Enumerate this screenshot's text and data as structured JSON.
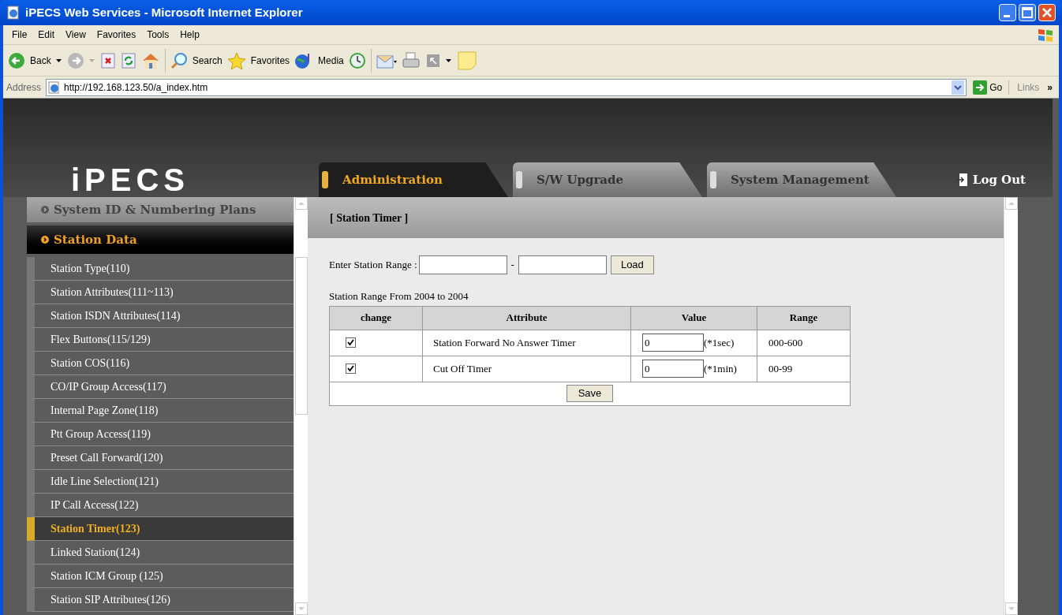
{
  "window": {
    "title": "iPECS Web Services - Microsoft Internet Explorer"
  },
  "menu": [
    "File",
    "Edit",
    "View",
    "Favorites",
    "Tools",
    "Help"
  ],
  "toolbar": {
    "back": "Back",
    "search": "Search",
    "favorites": "Favorites",
    "media": "Media"
  },
  "address_bar": {
    "label": "Address",
    "url": "http://192.168.123.50/a_index.htm",
    "go": "Go",
    "links": "Links",
    "more": "»"
  },
  "app": {
    "logo": "iPECS",
    "logout": "Log Out",
    "tabs": [
      {
        "label": "Administration",
        "selected": true
      },
      {
        "label": "S/W Upgrade",
        "selected": false
      },
      {
        "label": "System Management",
        "selected": false
      }
    ]
  },
  "sidebar": {
    "sections": [
      {
        "label": "System ID & Numbering Plans",
        "expanded": false
      },
      {
        "label": "Station Data",
        "expanded": true,
        "children": [
          {
            "label": "Station Type(110)",
            "selected": false
          },
          {
            "label": "Station Attributes(111~113)",
            "selected": false
          },
          {
            "label": "Station ISDN Attributes(114)",
            "selected": false
          },
          {
            "label": "Flex Buttons(115/129)",
            "selected": false
          },
          {
            "label": "Station COS(116)",
            "selected": false
          },
          {
            "label": "CO/IP Group Access(117)",
            "selected": false
          },
          {
            "label": "Internal Page Zone(118)",
            "selected": false
          },
          {
            "label": "Ptt Group Access(119)",
            "selected": false
          },
          {
            "label": "Preset Call Forward(120)",
            "selected": false
          },
          {
            "label": "Idle Line Selection(121)",
            "selected": false
          },
          {
            "label": "IP Call Access(122)",
            "selected": false
          },
          {
            "label": "Station Timer(123)",
            "selected": true
          },
          {
            "label": "Linked Station(124)",
            "selected": false
          },
          {
            "label": "Station ICM Group (125)",
            "selected": false
          },
          {
            "label": "Station SIP Attributes(126)",
            "selected": false
          }
        ]
      }
    ]
  },
  "content": {
    "title": "[ Station Timer ]",
    "range_label": "Enter Station Range :",
    "range_separator": "-",
    "load": "Load",
    "range_info": "Station Range From 2004 to 2004",
    "table": {
      "columns": [
        "change",
        "Attribute",
        "Value",
        "Range"
      ],
      "rows": [
        {
          "checked": true,
          "attribute": "Station Forward No Answer Timer",
          "value": "0",
          "unit": "(*1sec)",
          "range": "000-600"
        },
        {
          "checked": true,
          "attribute": "Cut Off Timer",
          "value": "0",
          "unit": "(*1min)",
          "range": "00-99"
        }
      ]
    },
    "save": "Save"
  }
}
